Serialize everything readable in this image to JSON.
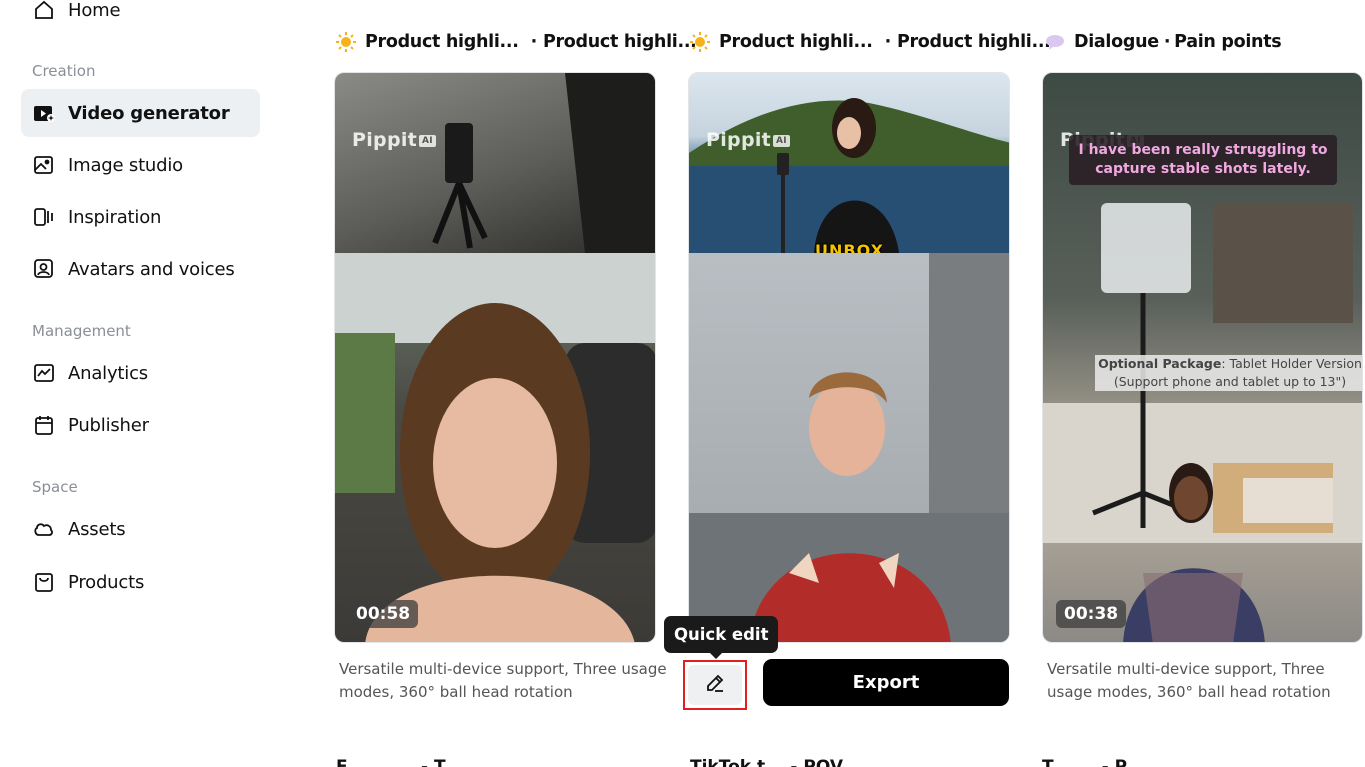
{
  "sidebar": {
    "home": {
      "label": "Home",
      "icon": "home-icon"
    },
    "sections": {
      "creation": "Creation",
      "management": "Management",
      "space": "Space"
    },
    "items": [
      {
        "label": "Video generator",
        "icon": "video-generator-icon",
        "active": true
      },
      {
        "label": "Image studio",
        "icon": "image-studio-icon"
      },
      {
        "label": "Inspiration",
        "icon": "inspiration-icon"
      },
      {
        "label": "Avatars and voices",
        "icon": "avatar-icon"
      },
      {
        "label": "Analytics",
        "icon": "analytics-icon"
      },
      {
        "label": "Publisher",
        "icon": "calendar-icon"
      },
      {
        "label": "Assets",
        "icon": "cloud-icon"
      },
      {
        "label": "Products",
        "icon": "bag-icon"
      }
    ]
  },
  "cards": [
    {
      "tag1": "Product highli...",
      "tag2": "Product highli...",
      "watermark": "Pippit",
      "watermark_badge": "AI",
      "duration": "00:58",
      "description": "Versatile multi-device support, Three usage modes, 360° ball head rotation"
    },
    {
      "tag1": "Product highli...",
      "tag2": "Product highli...",
      "watermark": "Pippit",
      "watermark_badge": "AI",
      "overlay_text": "UNBOX"
    },
    {
      "tag1": "Dialogue",
      "tag2": "Pain points",
      "watermark": "Pippit",
      "watermark_badge": "AI",
      "caption": "I have been really struggling to capture stable shots lately.",
      "optional_bold": "Optional Package",
      "optional_rest": ": Tablet Holder Version",
      "optional_line2": "(Support phone and tablet up to 13\")",
      "duration": "00:38",
      "description": "Versatile multi-device support, Three usage modes, 360° ball head rotation"
    }
  ],
  "actions": {
    "tooltip": "Quick edit",
    "export": "Export"
  },
  "next_row": [
    {
      "text": "F... ... ... - T..."
    },
    {
      "text": "TikTok t... - POV"
    },
    {
      "text": "T... ... - P..."
    }
  ],
  "colors": {
    "active_bg": "#edf0f3",
    "highlight_border": "#e02020",
    "export_bg": "#000000"
  }
}
